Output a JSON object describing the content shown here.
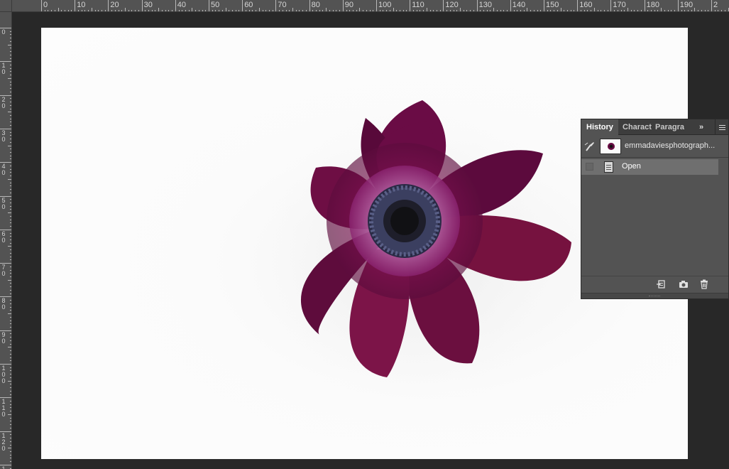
{
  "ruler": {
    "top_labels": [
      "0",
      "10",
      "20",
      "30",
      "40",
      "50",
      "60",
      "70",
      "80",
      "90",
      "100",
      "110",
      "120",
      "130",
      "140",
      "150",
      "160",
      "170",
      "180",
      "190",
      "2"
    ],
    "left_labels": [
      [
        "0"
      ],
      [
        "1",
        "0"
      ],
      [
        "2",
        "0"
      ],
      [
        "3",
        "0"
      ],
      [
        "4",
        "0"
      ],
      [
        "5",
        "0"
      ],
      [
        "6",
        "0"
      ],
      [
        "7",
        "0"
      ],
      [
        "8",
        "0"
      ],
      [
        "9",
        "0"
      ],
      [
        "1",
        "0",
        "0"
      ],
      [
        "1",
        "1",
        "0"
      ],
      [
        "1",
        "2",
        "0"
      ],
      [
        "1"
      ]
    ]
  },
  "panel": {
    "tabs": [
      {
        "label": "History",
        "active": true
      },
      {
        "label": "Charact",
        "active": false
      },
      {
        "label": "Paragra",
        "active": false
      }
    ],
    "overflow_glyph": "»",
    "snapshot_name": "emmadaviesphotograph...",
    "history_items": [
      {
        "label": "Open",
        "icon": "document-icon",
        "selected": true
      }
    ],
    "bottom_icons": [
      "new-document-from-state-icon",
      "camera-icon",
      "trash-icon"
    ]
  },
  "colors": {
    "workspace": "#282828",
    "ruler": "#535353",
    "panel": "#535353",
    "panel_tab_bar": "#3d3d3d",
    "selected_row": "#6f6f6f",
    "flower_petal": "#6a0d45"
  }
}
